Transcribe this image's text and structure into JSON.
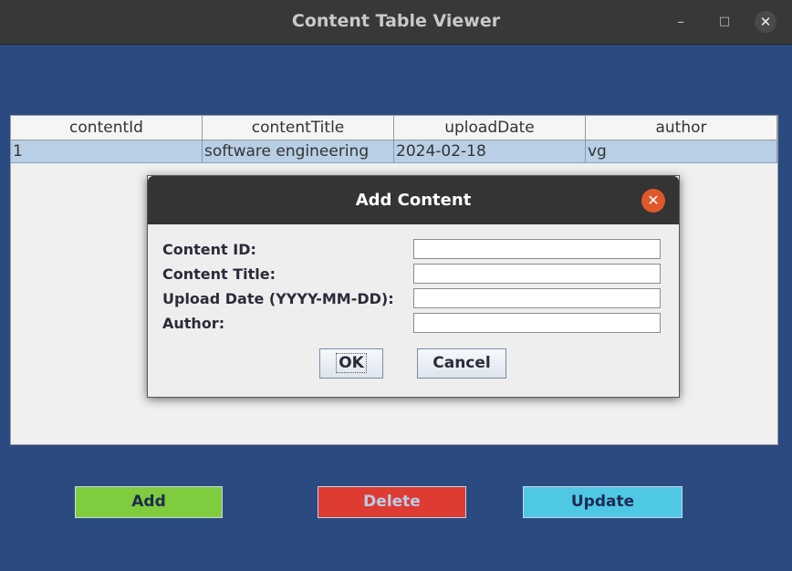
{
  "window": {
    "title": "Content Table Viewer",
    "minimize_icon": "minimize-icon",
    "maximize_icon": "maximize-icon",
    "close_icon": "close-icon"
  },
  "table": {
    "columns": [
      "contentId",
      "contentTitle",
      "uploadDate",
      "author"
    ],
    "rows": [
      [
        "1",
        "software engineering",
        "2024-02-18",
        "vg"
      ]
    ]
  },
  "dialog": {
    "title": "Add Content",
    "close_icon": "close-icon",
    "fields": [
      {
        "label": "Content ID:",
        "value": ""
      },
      {
        "label": "Content Title:",
        "value": ""
      },
      {
        "label": "Upload Date (YYYY-MM-DD):",
        "value": ""
      },
      {
        "label": "Author:",
        "value": ""
      }
    ],
    "ok_label": "OK",
    "cancel_label": "Cancel"
  },
  "actions": {
    "add_label": "Add",
    "delete_label": "Delete",
    "update_label": "Update"
  },
  "colors": {
    "background": "#2a4a80",
    "add": "#7fcc3f",
    "delete": "#de3b33",
    "update": "#4fc8e6",
    "dialog_close": "#e0582a",
    "selected_row": "#b8cfe5"
  }
}
